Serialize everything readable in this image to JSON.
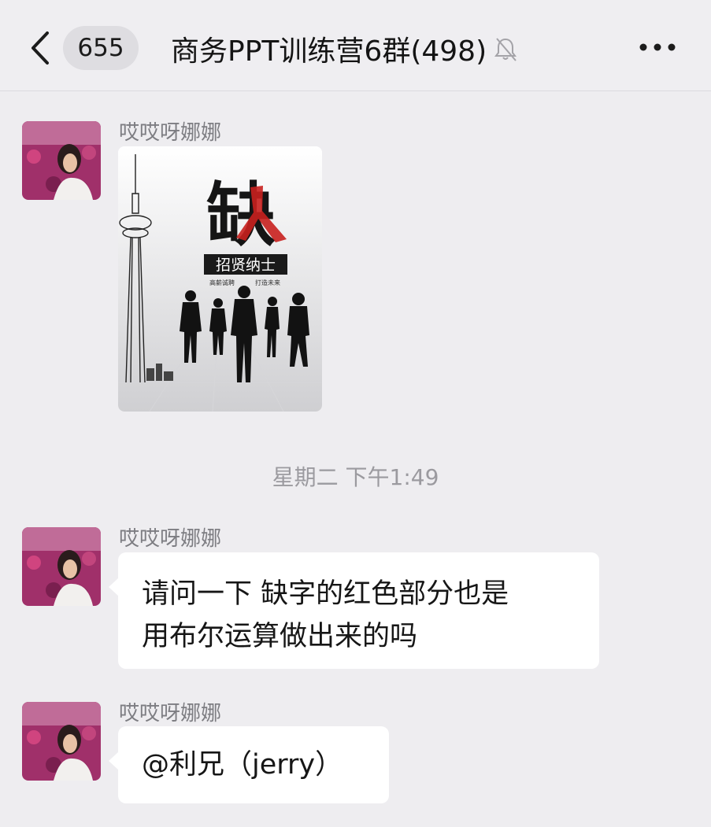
{
  "header": {
    "back_icon": "chevron-left-icon",
    "unread_count": "655",
    "title": "商务PPT训练营6群(498)",
    "mute_icon": "bell-slash-icon",
    "more_icon": "ellipsis-icon"
  },
  "messages": [
    {
      "sender": "哎哎呀娜娜",
      "type": "image",
      "poster": {
        "big_char": "缺",
        "banner": "招贤纳士",
        "sub_left": "高薪诚聘",
        "sub_right": "打造未来"
      }
    },
    {
      "sender": "哎哎呀娜娜",
      "type": "text",
      "lines": [
        "请问一下 缺字的红色部分也是",
        "用布尔运算做出来的吗"
      ]
    },
    {
      "sender": "哎哎呀娜娜",
      "type": "text",
      "lines": [
        "@利兄（jerry）"
      ]
    }
  ],
  "timestamp": "星期二 下午1:49",
  "colors": {
    "background": "#eeedf0",
    "bubble": "#ffffff",
    "poster_accent": "#c8201e"
  }
}
